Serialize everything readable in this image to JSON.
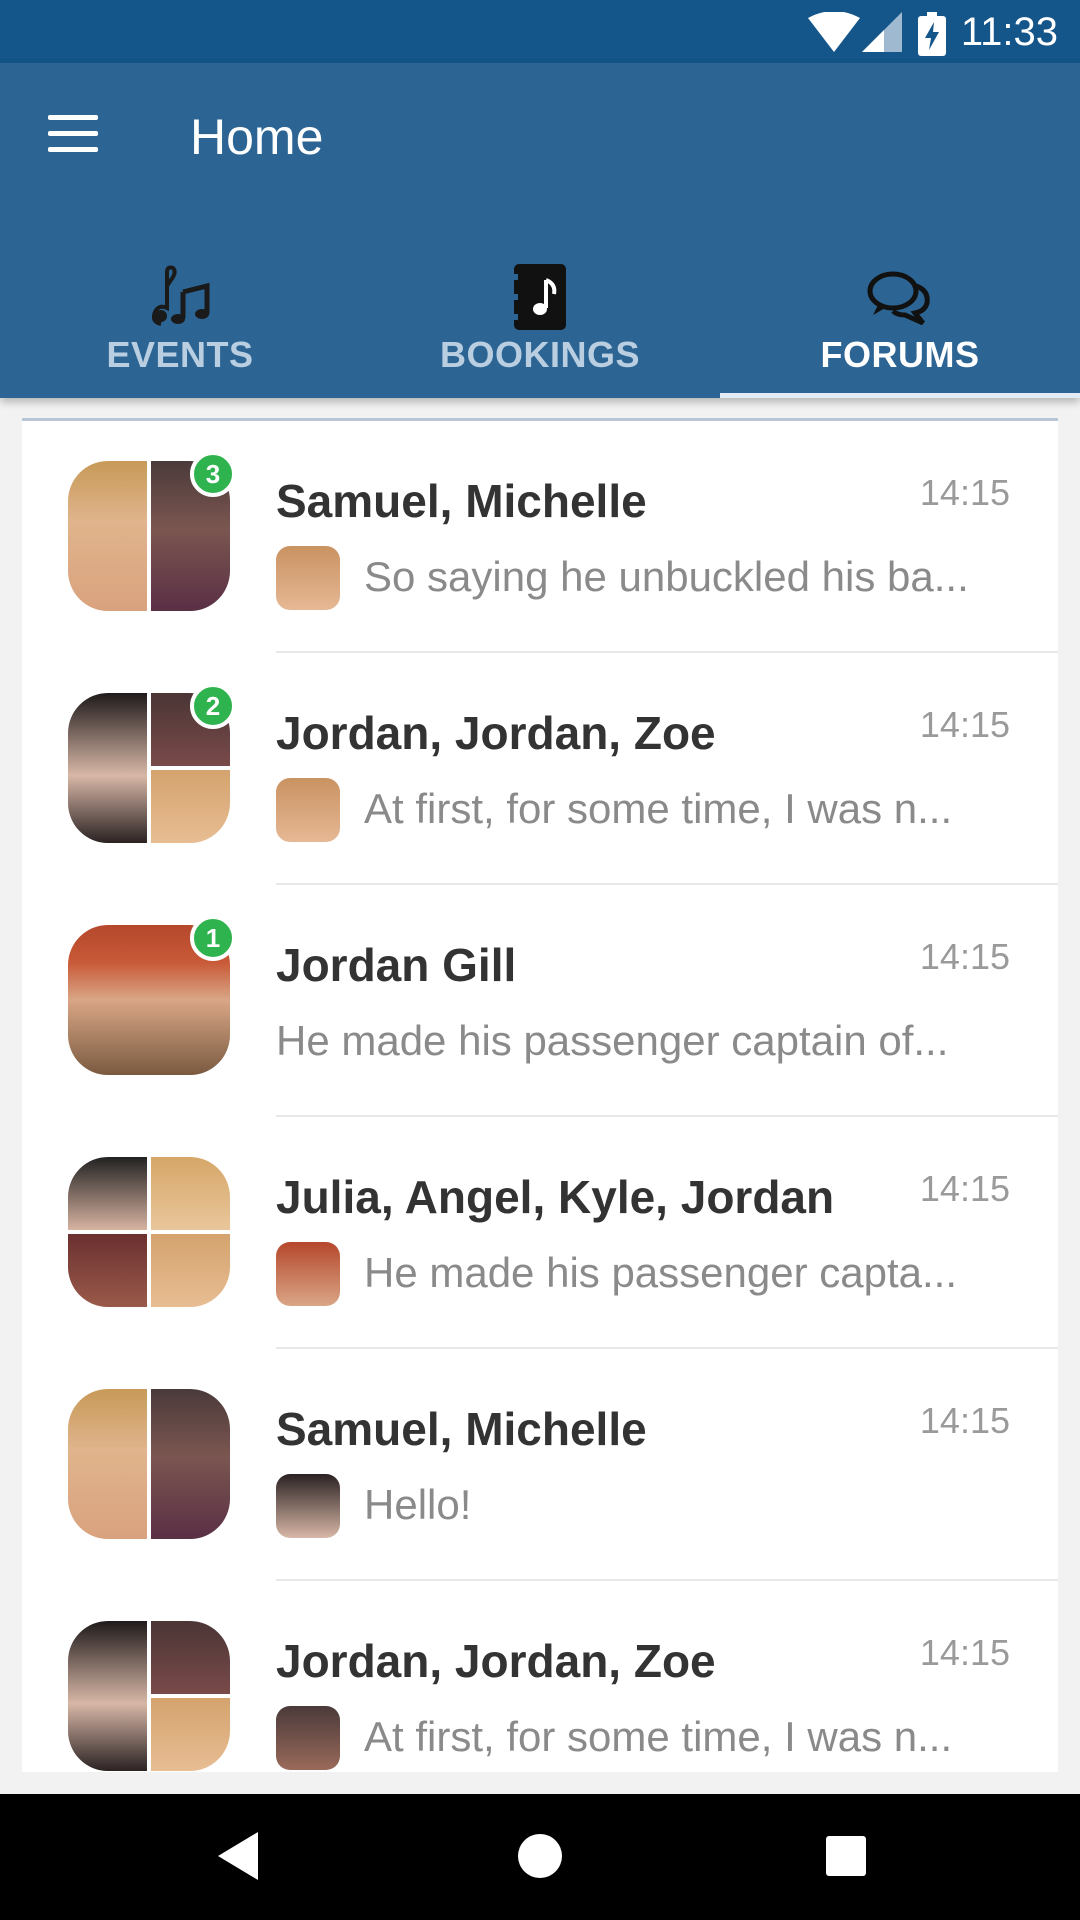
{
  "status_bar": {
    "time": "11:33",
    "icons": [
      "wifi-icon",
      "signal-icon",
      "battery-charging-icon"
    ]
  },
  "app_bar": {
    "title": "Home",
    "menu_icon": "menu-icon"
  },
  "tabs": [
    {
      "label": "EVENTS",
      "icon": "music-notes-icon",
      "active": false
    },
    {
      "label": "BOOKINGS",
      "icon": "music-book-icon",
      "active": false
    },
    {
      "label": "FORUMS",
      "icon": "chat-bubbles-icon",
      "active": true
    }
  ],
  "conversations": [
    {
      "name": "Samuel, Michelle",
      "time": "14:15",
      "preview": "So saying he unbuckled his ba...",
      "badge": "3",
      "has_mini_avatar": true
    },
    {
      "name": "Jordan, Jordan, Zoe",
      "time": "14:15",
      "preview": "At first, for some time, I was n...",
      "badge": "2",
      "has_mini_avatar": true
    },
    {
      "name": "Jordan Gill",
      "time": "14:15",
      "preview": "He made his passenger captain of...",
      "badge": "1",
      "has_mini_avatar": false
    },
    {
      "name": "Julia, Angel, Kyle, Jordan",
      "time": "14:15",
      "preview": "He made his passenger capta...",
      "badge": "",
      "has_mini_avatar": true
    },
    {
      "name": "Samuel, Michelle",
      "time": "14:15",
      "preview": "Hello!",
      "badge": "",
      "has_mini_avatar": true
    },
    {
      "name": "Jordan, Jordan, Zoe",
      "time": "14:15",
      "preview": "At first, for some time, I was n...",
      "badge": "",
      "has_mini_avatar": true
    }
  ],
  "nav_bar": {
    "icons": [
      "back-icon",
      "home-icon",
      "recents-icon"
    ]
  },
  "colors": {
    "status_bar": "#14558a",
    "app_bar": "#2c6594",
    "badge": "#2fb34e"
  }
}
